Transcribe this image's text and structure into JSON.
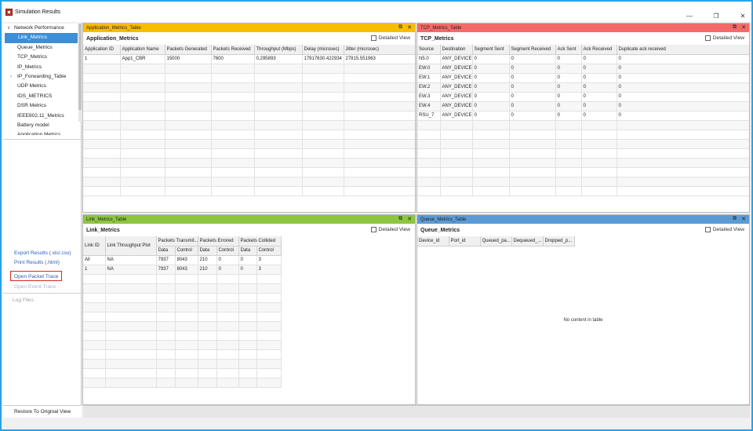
{
  "window": {
    "title": "Simulation Results"
  },
  "colors": {
    "app_header": "#f7bd00",
    "tcp_header": "#f46a6a",
    "link_header": "#8ec63f",
    "queue_header": "#5b9bd5",
    "selected": "#3b8fd6",
    "link_text": "#2a5db8",
    "highlight_border": "#e0281f"
  },
  "sidebar": {
    "tree": [
      {
        "label": "Network Performance",
        "level": "root",
        "expanded": true
      },
      {
        "label": "Link_Metrics",
        "selected": true
      },
      {
        "label": "Queue_Metrics"
      },
      {
        "label": "TCP_Metrics"
      },
      {
        "label": "IP_Metrics"
      },
      {
        "label": "IP_Forwarding_Table",
        "collapsible": true
      },
      {
        "label": "UDP Metrics"
      },
      {
        "label": "IDS_METRICS"
      },
      {
        "label": "DSR Metrics"
      },
      {
        "label": "IEEE802.11_Metrics"
      },
      {
        "label": "Battery model"
      },
      {
        "label": "Application Metrics"
      }
    ],
    "export_label": "Export Results (.xls/.csv)",
    "print_label": "Print Results (.html)",
    "packet_trace_label": "Open Packet Trace",
    "event_trace_label": "Open Event Trace",
    "log_files_label": "Log Files",
    "restore_label": "Restore To Original View"
  },
  "detailed_view_label": "Detailed View",
  "app_panel": {
    "header": "Application_Metrics_Table",
    "title": "Application_Metrics",
    "columns": [
      "Application ID",
      "Application Name",
      "Packets Generated",
      "Packets Received",
      "Throughput (Mbps)",
      "Delay (microsec)",
      "Jitter (microsec)"
    ],
    "rows": [
      [
        "1",
        "App1_CBR",
        "15000",
        "7600",
        "0.295893",
        "17917630.422934",
        "27815.551963"
      ]
    ]
  },
  "tcp_panel": {
    "header": "TCP_Metrics_Table",
    "title": "TCP_Metrics",
    "columns": [
      "Source",
      "Destination",
      "Segment Sent",
      "Segment Received",
      "Ack Sent",
      "Ack Received",
      "Duplicate ack received"
    ],
    "rows": [
      [
        "N5.0",
        "ANY_DEVICE",
        "0",
        "0",
        "0",
        "0",
        "0"
      ],
      [
        "EW.0",
        "ANY_DEVICE",
        "0",
        "0",
        "0",
        "0",
        "0"
      ],
      [
        "EW.1",
        "ANY_DEVICE",
        "0",
        "0",
        "0",
        "0",
        "0"
      ],
      [
        "EW.2",
        "ANY_DEVICE",
        "0",
        "0",
        "0",
        "0",
        "0"
      ],
      [
        "EW.3",
        "ANY_DEVICE",
        "0",
        "0",
        "0",
        "0",
        "0"
      ],
      [
        "EW.4",
        "ANY_DEVICE",
        "0",
        "0",
        "0",
        "0",
        "0"
      ],
      [
        "RSU_7",
        "ANY_DEVICE",
        "0",
        "0",
        "0",
        "0",
        "0"
      ]
    ]
  },
  "link_panel": {
    "header": "Link_Metrics_Table",
    "title": "Link_Metrics",
    "group_headers": [
      "Link ID",
      "Link Throughput Plot",
      "Packets Transmit...",
      "Packets Errored",
      "Packets Collided"
    ],
    "sub_headers": [
      "Data",
      "Control",
      "Data",
      "Control",
      "Data",
      "Control"
    ],
    "rows": [
      [
        "All",
        "NA",
        "7937",
        "8043",
        "210",
        "0",
        "0",
        "3"
      ],
      [
        "1",
        "NA",
        "7937",
        "8043",
        "210",
        "0",
        "0",
        "3"
      ]
    ]
  },
  "queue_panel": {
    "header": "Queue_Metrics_Table",
    "title": "Queue_Metrics",
    "columns": [
      "Device_id",
      "Port_id",
      "Queued_pa...",
      "Dequeued_...",
      "Dropped_p..."
    ],
    "empty_text": "No content in table"
  }
}
